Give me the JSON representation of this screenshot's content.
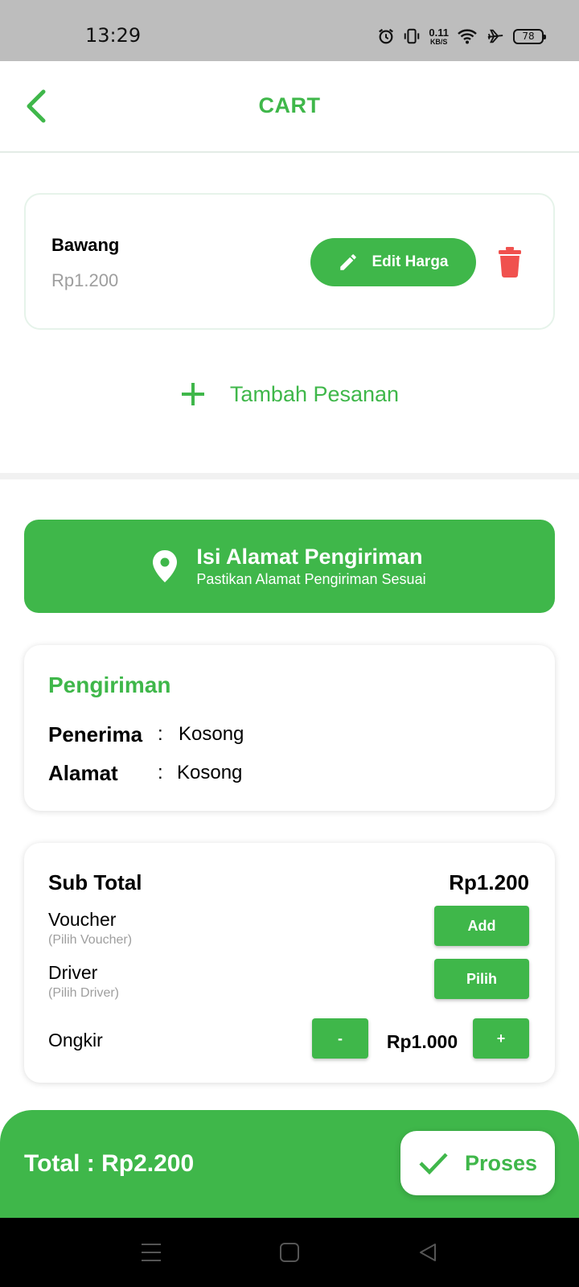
{
  "status_bar": {
    "time": "13:29",
    "net_speed_value": "0.11",
    "net_speed_unit": "KB/S",
    "battery": "78"
  },
  "header": {
    "title": "CART"
  },
  "cart_item": {
    "name": "Bawang",
    "price": "Rp1.200",
    "edit_label": "Edit Harga"
  },
  "add_order": {
    "label": "Tambah Pesanan"
  },
  "address_button": {
    "title": "Isi Alamat Pengiriman",
    "subtitle": "Pastikan Alamat Pengiriman Sesuai"
  },
  "shipping": {
    "title": "Pengiriman",
    "recipient_label": "Penerima",
    "recipient_value": "Kosong",
    "address_label": "Alamat",
    "address_value": "Kosong",
    "separator": ":"
  },
  "summary": {
    "subtotal_label": "Sub Total",
    "subtotal_value": "Rp1.200",
    "voucher_label": "Voucher",
    "voucher_hint": "(Pilih Voucher)",
    "voucher_button": "Add",
    "driver_label": "Driver",
    "driver_hint": "(Pilih Driver)",
    "driver_button": "Pilih",
    "ongkir_label": "Ongkir",
    "ongkir_minus": "-",
    "ongkir_value": "Rp1.000",
    "ongkir_plus": "+"
  },
  "footer": {
    "total": "Total : Rp2.200",
    "process_button": "Proses"
  },
  "colors": {
    "primary": "#3fb74a",
    "delete": "#f0514e",
    "muted": "#9e9e9e"
  },
  "icons": [
    "back-arrow-icon",
    "pencil-icon",
    "trash-icon",
    "plus-icon",
    "location-pin-icon",
    "check-icon"
  ]
}
